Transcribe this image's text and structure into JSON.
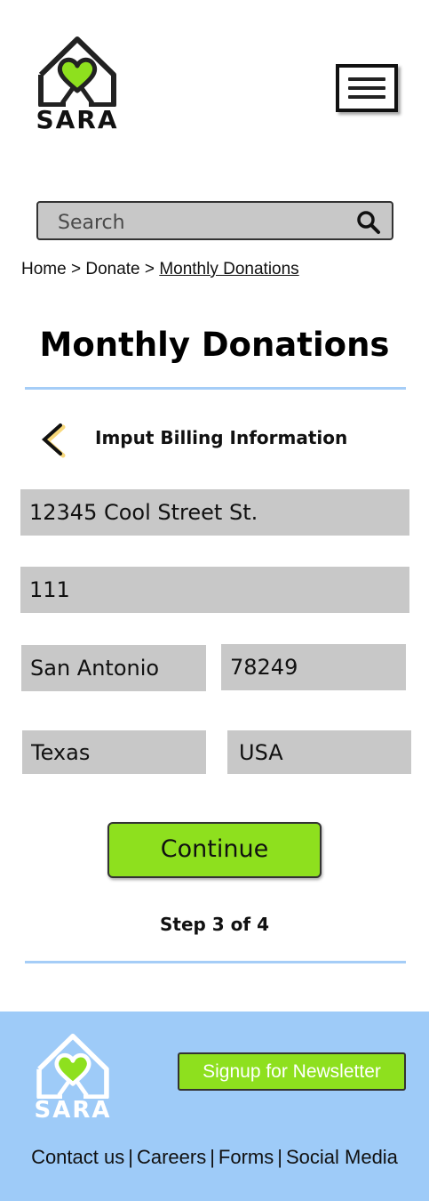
{
  "header": {
    "logo_text": "SARA",
    "menu_icon": "hamburger-icon"
  },
  "search": {
    "placeholder": "Search",
    "icon": "search-icon"
  },
  "breadcrumb": {
    "items": [
      "Home",
      "Donate",
      "Monthly Donations"
    ],
    "separator": ">"
  },
  "page": {
    "title": "Monthly Donations"
  },
  "billing": {
    "heading": "Imput Billing  Information",
    "back_icon": "chevron-left-icon",
    "fields": {
      "street": "12345 Cool Street St.",
      "unit": "111",
      "city": "San Antonio",
      "zip": "78249",
      "state": "Texas",
      "country": "USA"
    },
    "continue_label": "Continue",
    "step_text": "Step 3 of 4"
  },
  "footer": {
    "logo_text": "SARA",
    "newsletter_label": "Signup for Newsletter",
    "links": [
      "Contact us",
      "Careers",
      "Forms",
      "Social Media"
    ],
    "link_separator": "|"
  },
  "colors": {
    "accent_green": "#8ee01e",
    "footer_blue": "#9ecbf8",
    "divider_blue": "#a5cdf7",
    "field_gray": "#c8c8c8"
  }
}
